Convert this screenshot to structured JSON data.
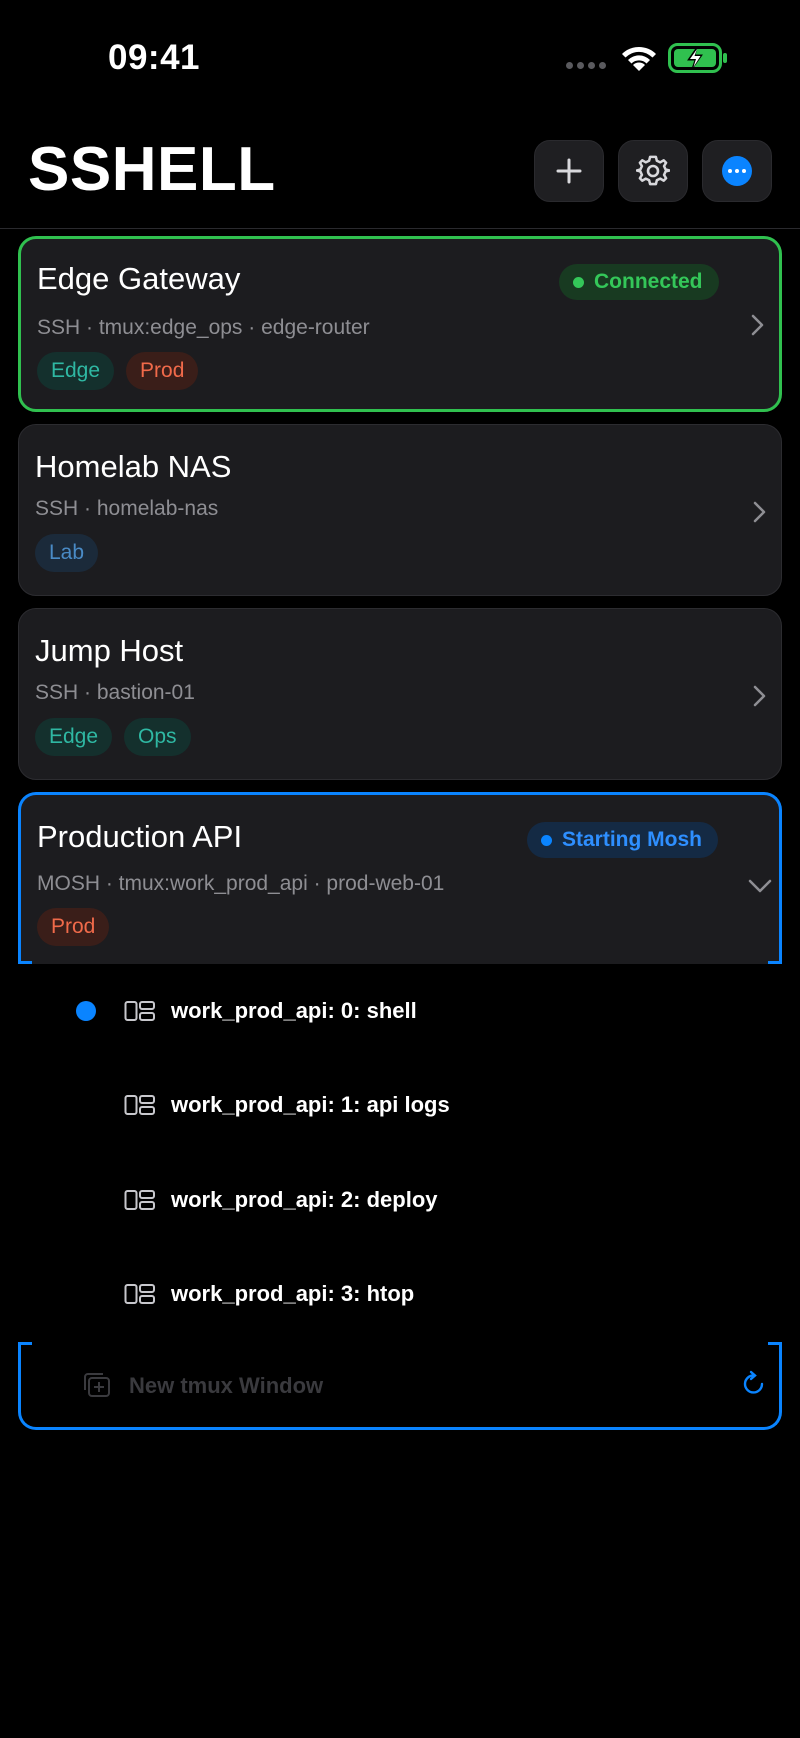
{
  "status_bar": {
    "time": "09:41"
  },
  "header": {
    "title": "SSHELL",
    "add_icon": "plus-icon",
    "settings_icon": "gear-icon",
    "more_icon": "ellipsis-circle-icon"
  },
  "hosts": [
    {
      "name": "Edge Gateway",
      "subtitle": "SSH · tmux:edge_ops · edge-router",
      "status": "Connected",
      "tags": [
        "Edge",
        "Prod"
      ]
    },
    {
      "name": "Homelab NAS",
      "subtitle": "SSH · homelab-nas",
      "tags": [
        "Lab"
      ]
    },
    {
      "name": "Jump Host",
      "subtitle": "SSH · bastion-01",
      "tags": [
        "Edge",
        "Ops"
      ]
    },
    {
      "name": "Production API",
      "subtitle": "MOSH · tmux:work_prod_api · prod-web-01",
      "status": "Starting Mosh",
      "tags": [
        "Prod"
      ]
    }
  ],
  "sessions": [
    {
      "label": "work_prod_api: 0: shell",
      "active": true
    },
    {
      "label": "work_prod_api: 1: api logs",
      "active": false
    },
    {
      "label": "work_prod_api: 2: deploy",
      "active": false
    },
    {
      "label": "work_prod_api: 3: htop",
      "active": false
    }
  ],
  "new_window": {
    "label": "New tmux Window"
  },
  "colors": {
    "accent": "#0a84ff",
    "connected": "#34c759",
    "prod": "#f06a4a",
    "edge": "#2fb8a3",
    "lab": "#4a8bc6"
  }
}
